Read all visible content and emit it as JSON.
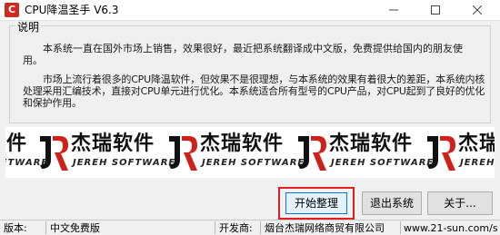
{
  "window": {
    "title": "CPU降温圣手 V6.3",
    "icon": "cpu-flame-icon",
    "minimize": "minimize-icon",
    "maximize": "maximize-icon",
    "close": "close-icon"
  },
  "description": {
    "legend": "说明",
    "paragraph1": "本系统一直在国外市场上销售，效果很好，最近把系统翻译成中文版，免费提供给国内的朋友使用。",
    "paragraph2": "市场上流行着很多的CPU降温软件，但效果不是很理想，与本系统的效果有着很大的差距，本系统内核处理采用汇编技术，直接对CPU单元进行优化。本系统适合所有型号的CPU产品，对CPU起到了良好的优化和保护作用。"
  },
  "banner": {
    "logo_cn": "杰瑞软件",
    "logo_en": "JEREH SOFTWARE",
    "accent": "#d0201a"
  },
  "buttons": {
    "start": "开始整理",
    "exit": "退出系统",
    "about": "关于..."
  },
  "statusbar": {
    "version_label": "版本:",
    "version_value": "中文免费版",
    "developer_label": "开发商:",
    "developer_value": "烟台杰瑞网络商贸有限公司",
    "website": "www.21-sun.com/s"
  }
}
